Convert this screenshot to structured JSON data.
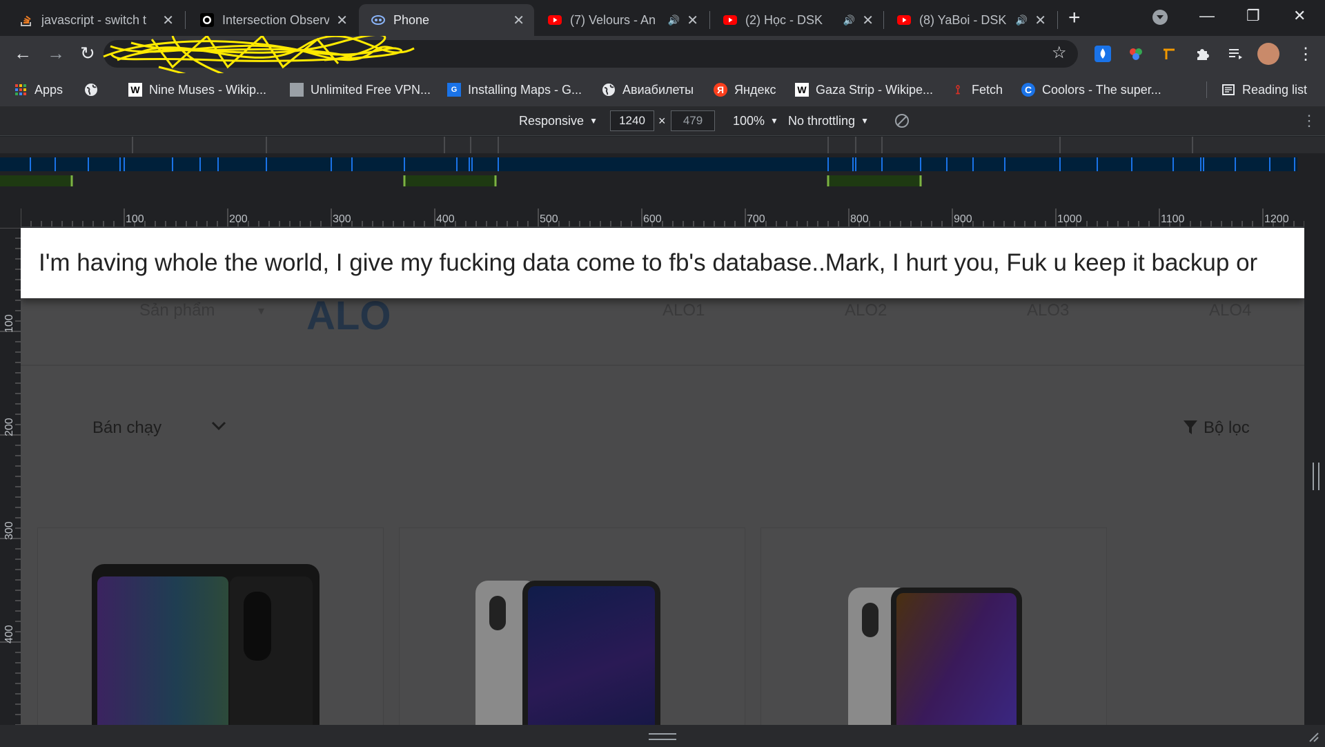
{
  "tabs": [
    {
      "title": "javascript - switch t",
      "close": "✕"
    },
    {
      "title": "Intersection Observ",
      "close": "✕"
    },
    {
      "title": "Phone",
      "close": "✕"
    },
    {
      "title": "(7) Velours - An",
      "mute": "🔊",
      "close": "✕"
    },
    {
      "title": "(2) Học - DSK",
      "mute": "🔊",
      "close": "✕"
    },
    {
      "title": "(8) YaBoi - DSK",
      "mute": "🔊",
      "close": "✕"
    }
  ],
  "window_controls": {
    "new_tab": "+",
    "minimize": "—",
    "restore": "❐",
    "close": "✕"
  },
  "nav": {
    "back": "←",
    "forward": "→",
    "reload": "↻",
    "star": "☆",
    "menu": "⋮"
  },
  "bookmarks": [
    {
      "label": "Apps"
    },
    {
      "label": ""
    },
    {
      "label": "Nine Muses - Wikip..."
    },
    {
      "label": "Unlimited Free VPN..."
    },
    {
      "label": "Installing Maps - G..."
    },
    {
      "label": "Авиабилеты"
    },
    {
      "label": "Яндекс"
    },
    {
      "label": "Gaza Strip - Wikipe..."
    },
    {
      "label": "Fetch"
    },
    {
      "label": "Coolors - The super..."
    }
  ],
  "reading_list": "Reading list",
  "device_toolbar": {
    "mode": "Responsive",
    "width": "1240",
    "times": "×",
    "height": "479",
    "zoom": "100%",
    "throttling": "No throttling"
  },
  "ruler": {
    "h_ticks": [
      "100",
      "200",
      "300",
      "400",
      "500",
      "600",
      "700",
      "800",
      "900",
      "1000",
      "1100",
      "1200"
    ],
    "v_ticks": [
      "100",
      "200",
      "300",
      "400"
    ]
  },
  "page": {
    "banner": "I'm having whole the world, I give my fucking data come to fb's database..Mark, I hurt you, Fuk u keep it backup or",
    "nav_product": "Sản phẩm",
    "logo": "ALO",
    "nav_items": [
      "ALO1",
      "ALO2",
      "ALO3",
      "ALO4"
    ],
    "sort": "Bán chạy",
    "sort_chevron": "⌄",
    "filter": "Bộ lọc"
  },
  "colors": {
    "chrome_bg": "#202124",
    "toolbar_bg": "#35363a",
    "page_overlay": "#4a4a4b",
    "banner_bg": "#ffffff",
    "scribble": "#ffea00",
    "youtube_red": "#ff0000"
  },
  "icons": [
    "chrome-icon",
    "github-icon",
    "phone-favicon-icon",
    "youtube-icon",
    "apps-grid-icon",
    "globe-icon",
    "wikipedia-icon",
    "vpn-icon",
    "maps-icon",
    "yandex-icon",
    "fetch-icon",
    "coolors-icon",
    "reading-list-icon",
    "star-icon",
    "extension-icon",
    "filter-icon",
    "chevron-down-icon",
    "rotate-icon"
  ]
}
